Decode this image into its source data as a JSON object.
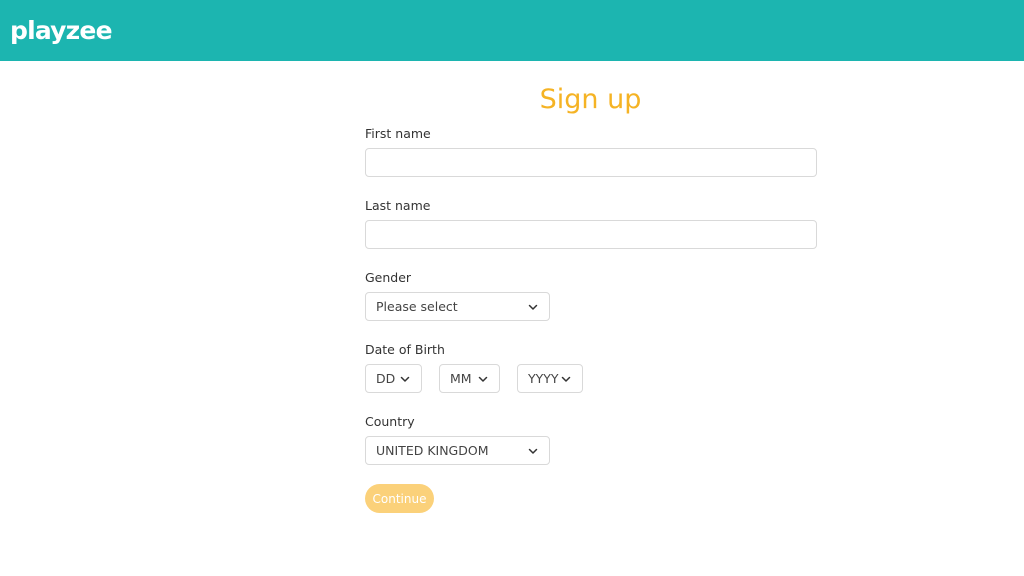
{
  "header": {
    "logo_text": "playzee",
    "background_color": "#1cb5b0"
  },
  "form": {
    "title": "Sign up",
    "title_color": "#f5b324",
    "first_name": {
      "label": "First name",
      "value": ""
    },
    "last_name": {
      "label": "Last name",
      "value": ""
    },
    "gender": {
      "label": "Gender",
      "selected": "Please select"
    },
    "date_of_birth": {
      "label": "Date of Birth",
      "day": "DD",
      "month": "MM",
      "year": "YYYY"
    },
    "country": {
      "label": "Country",
      "selected": "UNITED KINGDOM"
    },
    "continue_label": "Continue",
    "continue_color": "#fbd17a"
  }
}
